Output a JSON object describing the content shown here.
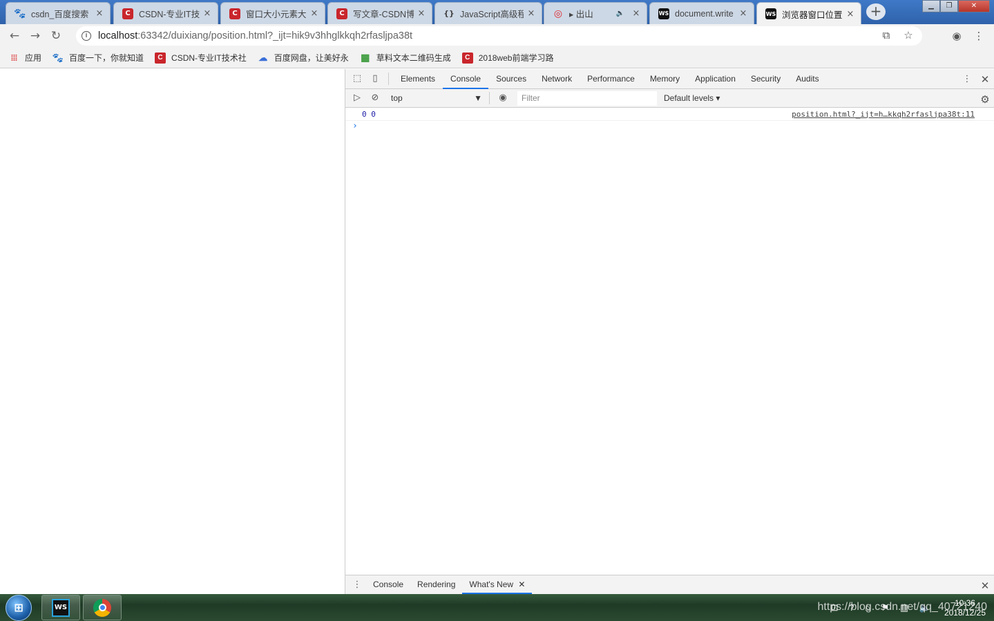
{
  "browser": {
    "tabs": [
      {
        "title": "csdn_百度搜索",
        "icon": "paw-icon"
      },
      {
        "title": "CSDN-专业IT技",
        "icon": "csdn-icon"
      },
      {
        "title": "窗口大小元素大小",
        "icon": "csdn-icon"
      },
      {
        "title": "写文章-CSDN博",
        "icon": "csdn-icon"
      },
      {
        "title": "JavaScript高级程",
        "icon": "code-icon"
      },
      {
        "title": "▸ 出山",
        "icon": "music-icon",
        "audio": "🔈"
      },
      {
        "title": "document.write",
        "icon": "webstorm-icon"
      },
      {
        "title": "浏览器窗口位置",
        "icon": "webstorm-icon",
        "active": true
      }
    ],
    "tab_close": "×",
    "new_tab": "+",
    "url_host": "localhost",
    "url_rest": ":63342/duixiang/position.html?_ijt=hik9v3hhglkkqh2rfasljpa38t",
    "bookmarks": [
      {
        "label": "应用",
        "icon": "apps-icon"
      },
      {
        "label": "百度一下，你就知道",
        "icon": "paw-icon"
      },
      {
        "label": "CSDN-专业IT技术社",
        "icon": "csdn-icon"
      },
      {
        "label": "百度网盘，让美好永",
        "icon": "cloud-icon"
      },
      {
        "label": "草料文本二维码生成",
        "icon": "qr-icon"
      },
      {
        "label": "2018web前端学习路",
        "icon": "csdn-icon"
      }
    ]
  },
  "devtools": {
    "tabs": [
      "Elements",
      "Console",
      "Sources",
      "Network",
      "Performance",
      "Memory",
      "Application",
      "Security",
      "Audits"
    ],
    "active_tab": "Console",
    "context": "top",
    "filter_placeholder": "Filter",
    "levels": "Default levels ▾",
    "messages": [
      {
        "text": "0 0",
        "source": "position.html?_ijt=h…kkqh2rfasljpa38t:11"
      }
    ],
    "prompt": "›",
    "drawer_tabs": [
      "Console",
      "Rendering",
      "What's New"
    ],
    "drawer_active": "What's New"
  },
  "taskbar": {
    "time": "10:36",
    "date": "2018/12/25",
    "watermark": "https://blog.csdn.net/qq_40721240"
  },
  "colors": {
    "accent": "#1a73e8",
    "csdn": "#c9262c"
  }
}
